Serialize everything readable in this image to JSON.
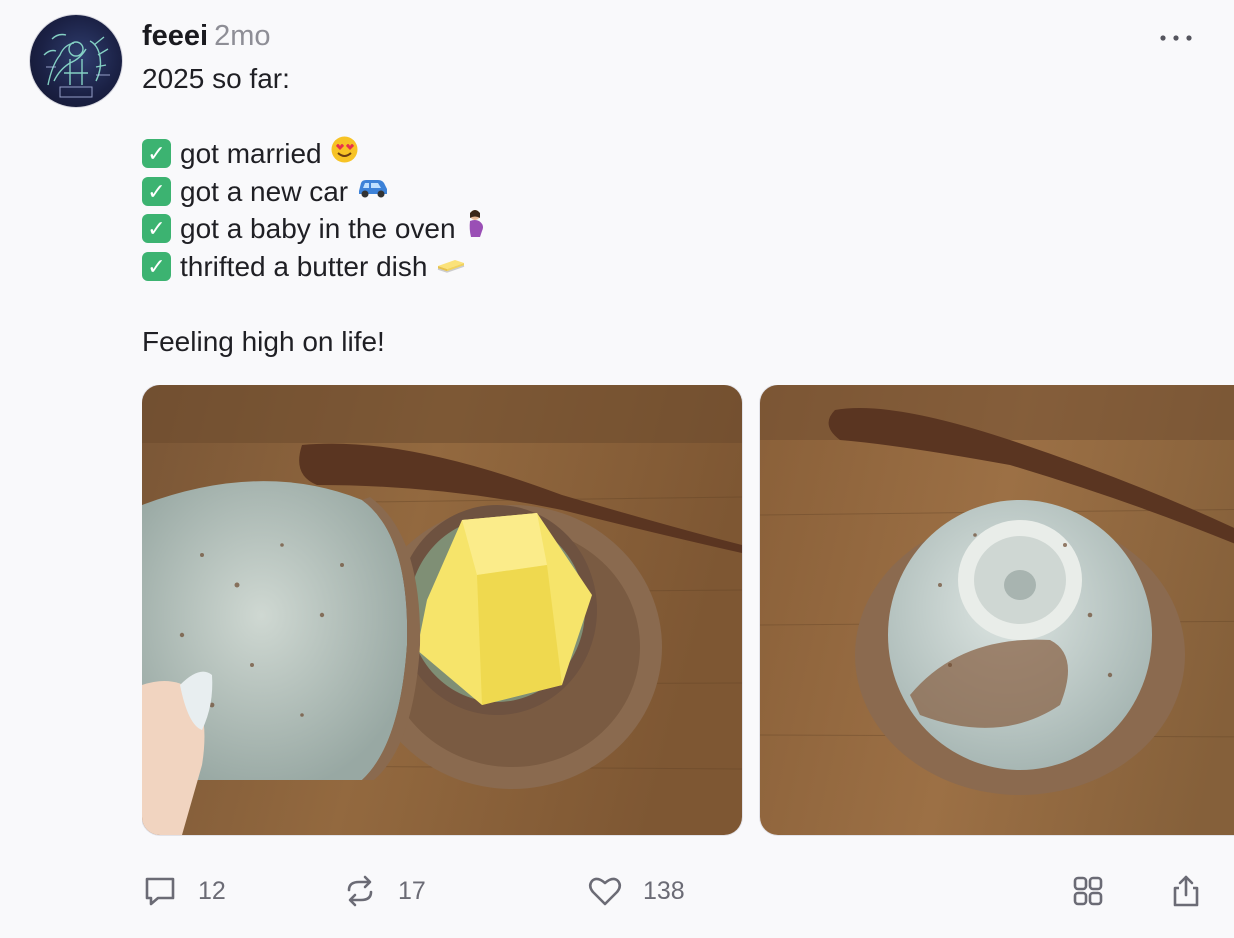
{
  "post": {
    "author": "feeei",
    "time": "2mo",
    "lines": {
      "intro": "2025 so far:",
      "item1": "got married",
      "item2": "got a new car",
      "item3": "got a baby in the oven",
      "item4": "thrifted a butter dish",
      "closing": "Feeling high on life!"
    },
    "emoji": {
      "item1": "heart-eyes-face",
      "item2": "car",
      "item3": "pregnant-woman",
      "item4": "butter"
    },
    "check_icon": "check-mark-button"
  },
  "stats": {
    "replies": "12",
    "reposts": "17",
    "likes": "138"
  },
  "icons": {
    "reply": "speech-bubble-icon",
    "repost": "repost-icon",
    "like": "heart-icon",
    "grid": "grid-icon",
    "share": "share-icon",
    "more": "ellipsis-icon"
  },
  "colors": {
    "check": "#3cb371",
    "muted": "#8e8e96",
    "background": "#f9f9fb"
  }
}
